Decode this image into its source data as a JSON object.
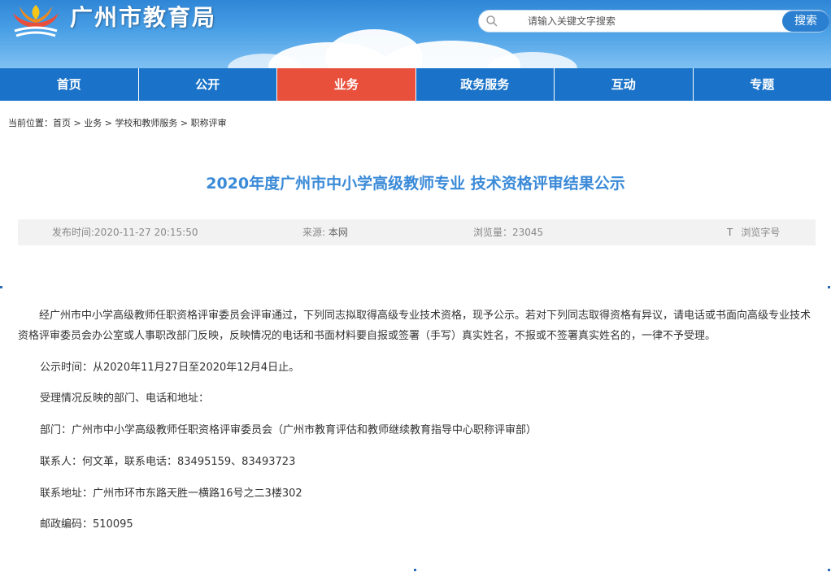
{
  "header": {
    "site_title": "广州市教育局",
    "search_placeholder": "请输入关键文字搜索",
    "search_button": "搜索"
  },
  "nav": {
    "items": [
      "首页",
      "公开",
      "业务",
      "政务服务",
      "互动",
      "专题"
    ],
    "active_index": 2
  },
  "breadcrumb": {
    "prefix": "当前位置：",
    "items": [
      "首页",
      "业务",
      "学校和教师服务",
      "职称评审"
    ],
    "separator": " > "
  },
  "article": {
    "title": "2020年度广州市中小学高级教师专业 技术资格评审结果公示",
    "meta": {
      "date": "发布时间:2020-11-27 20:15:50",
      "source_label": "来源: ",
      "source_value": "本网",
      "views": "浏览量：23045",
      "font_icon": "T",
      "font_label": "浏览字号"
    },
    "paragraphs": [
      "经广州市中小学高级教师任职资格评审委员会评审通过，下列同志拟取得高级专业技术资格，现予公示。若对下列同志取得资格有异议，请电话或书面向高级专业技术资格评审委员会办公室或人事职改部门反映，反映情况的电话和书面材料要自报或签署（手写）真实姓名，不报或不签署真实姓名的，一律不予受理。",
      "公示时间：从2020年11月27日至2020年12月4日止。",
      "受理情况反映的部门、电话和地址：",
      "部门：广州市中小学高级教师任职资格评审委员会（广州市教育评估和教师继续教育指导中心职称评审部）",
      "联系人：何文革，联系电话：83495159、83493723",
      "联系地址：广州市环市东路天胜一横路16号之二3楼302",
      "邮政编码：510095"
    ]
  },
  "colors": {
    "nav_bg": "#1a73c8",
    "nav_active": "#e8503c",
    "title": "#3a8ad8",
    "meta_bg": "#f2f2f2"
  }
}
